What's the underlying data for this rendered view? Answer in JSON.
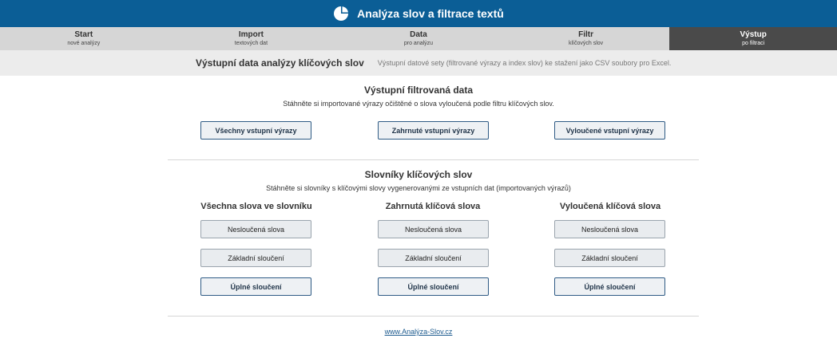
{
  "header": {
    "title": "Analýza slov a filtrace textů",
    "logo_icon": "pie-chart-icon",
    "bg_color": "#0b5e96"
  },
  "steps": [
    {
      "title": "Start",
      "sub": "nové analýzy"
    },
    {
      "title": "Import",
      "sub": "textových dat"
    },
    {
      "title": "Data",
      "sub": "pro analýzu"
    },
    {
      "title": "Filtr",
      "sub": "klíčových slov"
    },
    {
      "title": "Výstup",
      "sub": "po filtraci",
      "active": true
    }
  ],
  "subheader": {
    "title": "Výstupní data analýzy klíčových slov",
    "desc": "Výstupní datové sety (filtrované výrazy a index slov) ke stažení jako CSV soubory pro Excel."
  },
  "filtered": {
    "title": "Výstupní filtrovaná data",
    "desc": "Stáhněte si importované výrazy očištěné o slova vyloučená podle filtru klíčových slov.",
    "buttons": [
      "Všechny vstupní výrazy",
      "Zahrnuté vstupní výrazy",
      "Vyloučené vstupní výrazy"
    ]
  },
  "dictionaries": {
    "title": "Slovníky klíčových slov",
    "desc": "Stáhněte si slovníky s klíčovými slovy vygenerovanými ze vstupních dat (importovaných výrazů)",
    "columns": [
      {
        "title": "Všechna slova ve slovníku",
        "buttons": [
          "Nesloučená slova",
          "Základní sloučení",
          "Úplné sloučení"
        ]
      },
      {
        "title": "Zahrnutá klíčová slova",
        "buttons": [
          "Nesloučená slova",
          "Základní sloučení",
          "Úplné sloučení"
        ]
      },
      {
        "title": "Vyloučená klíčová slova",
        "buttons": [
          "Nesloučená slova",
          "Základní sloučení",
          "Úplné sloučení"
        ]
      }
    ]
  },
  "footer": {
    "link": "www.Analýza-Slov.cz"
  }
}
